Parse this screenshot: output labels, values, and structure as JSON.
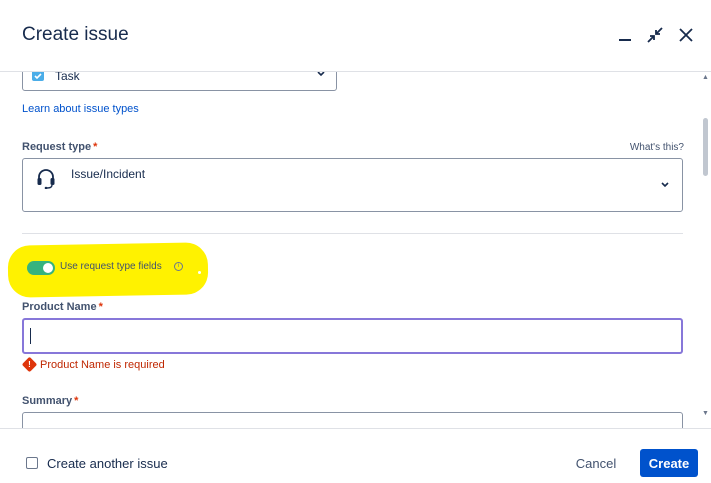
{
  "header": {
    "title": "Create issue",
    "minimize_icon": "minimize-icon",
    "collapse_icon": "collapse-arrows-icon",
    "close_icon": "close-icon"
  },
  "issue_type": {
    "value": "Task",
    "icon": "task-checkbox-icon",
    "learn_link": "Learn about issue types"
  },
  "request_type": {
    "label": "Request type",
    "required_marker": "*",
    "help_link": "What's this?",
    "value": "Issue/Incident",
    "icon": "headset-icon"
  },
  "toggle": {
    "label": "Use request type fields",
    "checked": true,
    "info_icon": "info-icon"
  },
  "product_name": {
    "label": "Product Name",
    "required_marker": "*",
    "value": "",
    "error": "Product Name is required"
  },
  "summary": {
    "label": "Summary",
    "required_marker": "*"
  },
  "footer": {
    "create_another_label": "Create another issue",
    "create_another_checked": false,
    "cancel_label": "Cancel",
    "create_label": "Create"
  },
  "colors": {
    "primary": "#0052cc",
    "toggle_on": "#36b37e",
    "error": "#de350b",
    "highlight": "#fff200",
    "focus_border": "#8777d9"
  }
}
